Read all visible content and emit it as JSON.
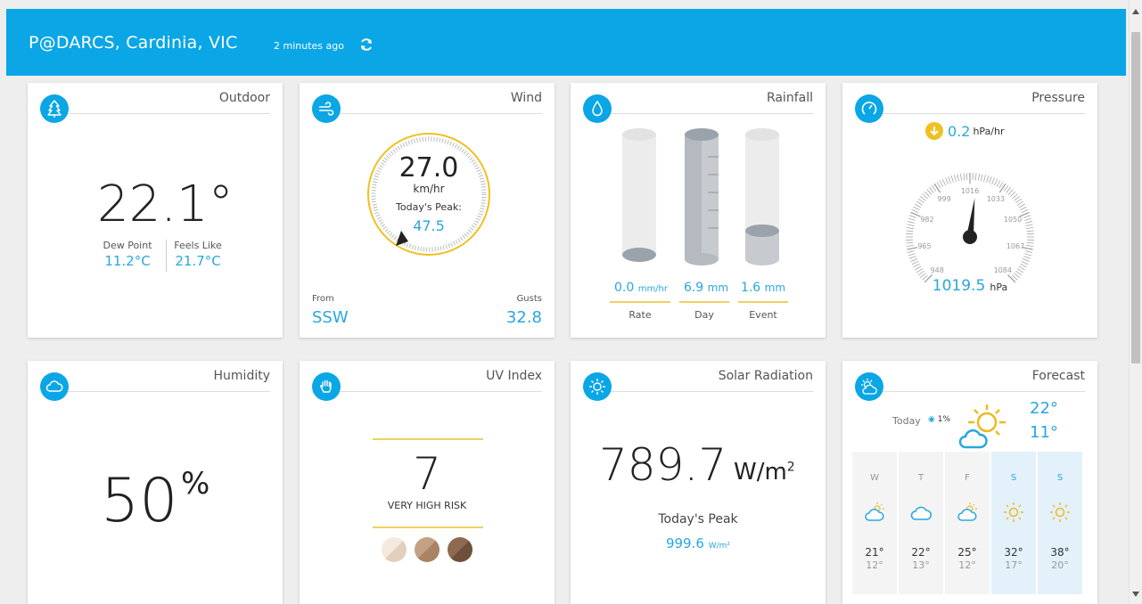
{
  "header": {
    "station": "P@DARCS, Cardinia, VIC",
    "updated": "2 minutes ago",
    "refresh_icon": "refresh-icon"
  },
  "colors": {
    "accent": "#0aa6e6",
    "value_blue": "#29a7df",
    "gold": "#f0c020"
  },
  "outdoor": {
    "title": "Outdoor",
    "icon": "tree-icon",
    "temperature": "22.1°",
    "dew_point_label": "Dew Point",
    "dew_point": "11.2°C",
    "feels_like_label": "Feels Like",
    "feels_like": "21.7°C"
  },
  "wind": {
    "title": "Wind",
    "icon": "wind-icon",
    "speed": "27.0",
    "unit": "km/hr",
    "peak_label": "Today's Peak:",
    "peak": "47.5",
    "from_label": "From",
    "direction": "SSW",
    "gusts_label": "Gusts",
    "gusts": "32.8"
  },
  "rainfall": {
    "title": "Rainfall",
    "icon": "drop-icon",
    "rate": "0.0",
    "rate_unit": "mm/hr",
    "day": "6.9",
    "day_unit": "mm",
    "event": "1.6",
    "event_unit": "mm",
    "rate_label": "Rate",
    "day_label": "Day",
    "event_label": "Event",
    "rate_fill": 0.0,
    "day_fill": 1.0,
    "event_fill": 0.25
  },
  "pressure": {
    "title": "Pressure",
    "icon": "gauge-icon",
    "trend": "0.2",
    "trend_unit": "hPa/hr",
    "trend_icon": "down-arrow-icon",
    "value": "1019.5",
    "unit": "hPa",
    "ticks": [
      "948",
      "965",
      "982",
      "999",
      "1016",
      "1033",
      "1050",
      "1067",
      "1084"
    ],
    "needle_value": 1019.5
  },
  "humidity": {
    "title": "Humidity",
    "icon": "cloud-icon",
    "value": "50",
    "unit": "%"
  },
  "uv": {
    "title": "UV Index",
    "icon": "hand-icon",
    "value": "7",
    "risk": "VERY HIGH RISK"
  },
  "solar": {
    "title": "Solar Radiation",
    "icon": "sun-icon",
    "value": "789.7",
    "unit": "W/m",
    "unit_sup": "2",
    "peak_label": "Today's Peak",
    "peak": "999.6",
    "peak_unit": "W/m²"
  },
  "forecast": {
    "title": "Forecast",
    "icon": "sun-cloud-icon",
    "today_label": "Today",
    "rain_chance": "1%",
    "today_hi": "22°",
    "today_lo": "11°",
    "days": [
      {
        "label": "W",
        "icon": "partly-cloudy-icon",
        "hi": "21°",
        "lo": "12°"
      },
      {
        "label": "T",
        "icon": "cloud-icon",
        "hi": "22°",
        "lo": "13°"
      },
      {
        "label": "F",
        "icon": "partly-cloudy-icon",
        "hi": "25°",
        "lo": "12°"
      },
      {
        "label": "S",
        "icon": "sun-icon",
        "hi": "32°",
        "lo": "17°"
      },
      {
        "label": "S",
        "icon": "sun-icon",
        "hi": "38°",
        "lo": "20°"
      }
    ]
  }
}
